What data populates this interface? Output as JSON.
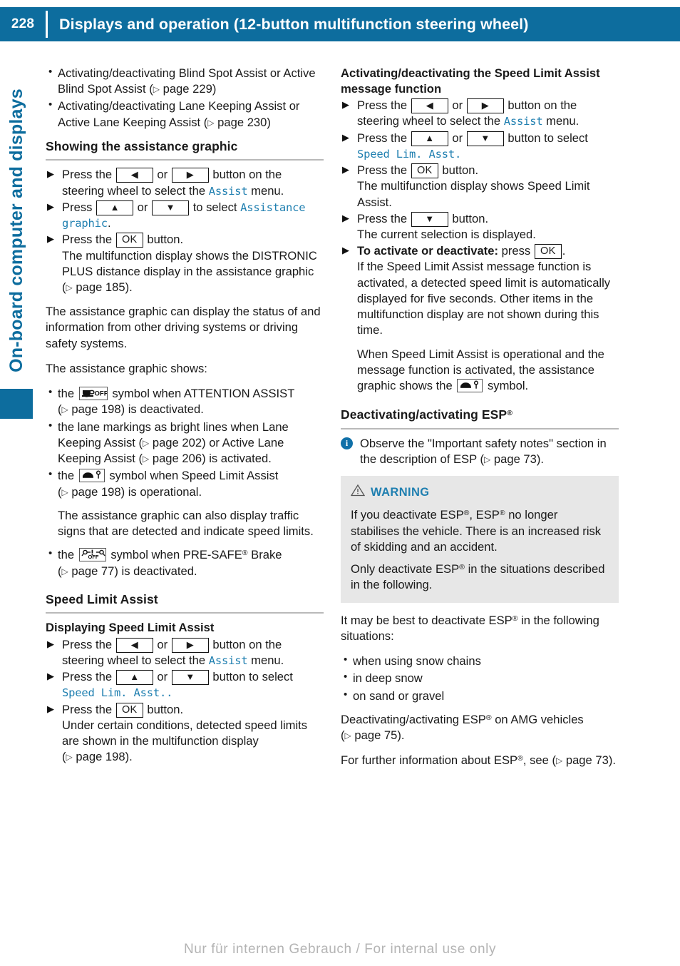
{
  "header": {
    "page_number": "228",
    "title": "Displays and operation (12-button multifunction steering wheel)",
    "bg_color": "#0d6d9e"
  },
  "sidebar": {
    "label": "On-board computer and displays",
    "color": "#0d6d9e"
  },
  "keys": {
    "left": "◀",
    "right": "▶",
    "up": "▲",
    "down": "▼",
    "ok": "OK"
  },
  "left_column": {
    "intro_bullets": [
      {
        "text_1": "Activating/deactivating Blind Spot Assist or Active Blind Spot Assist (",
        "xref": "page 229",
        "text_2": ")"
      },
      {
        "text_1": "Activating/deactivating Lane Keeping Assist or Active Lane Keeping Assist (",
        "xref": "page 230",
        "text_2": ")"
      }
    ],
    "section_showing": {
      "heading": "Showing the assistance graphic",
      "step1_a": "Press the",
      "step1_or": "or",
      "step1_b": "button on the steering wheel to select the",
      "step1_menu": "Assist",
      "step1_c": "menu.",
      "step2_a": "Press",
      "step2_or": "or",
      "step2_b": "to select",
      "step2_item": "Assistance graphic",
      "step2_c": ".",
      "step3_a": "Press the",
      "step3_b": "button.",
      "step3_result_1": "The multifunction display shows the DISTRONIC PLUS distance display in the assistance graphic (",
      "step3_xref": "page 185",
      "step3_result_2": ")."
    },
    "para_status": "The assistance graphic can display the status of and information from other driving systems or driving safety systems.",
    "para_shows": "The assistance graphic shows:",
    "symbol_bullets": [
      {
        "icon": "attention-assist-off-symbol",
        "pre": "the",
        "post_1": "symbol when ATTENTION ASSIST (",
        "xref": "page 198",
        "post_2": ") is deactivated."
      },
      {
        "icon": "none",
        "pre": "",
        "post_1": "the lane markings as bright lines when Lane Keeping Assist (",
        "xref": "page 202",
        "post_2": ") or Active Lane Keeping Assist (",
        "xref2": "page 206",
        "post_3": ") is activated."
      },
      {
        "icon": "speed-limit-assist-symbol",
        "pre": "the",
        "post_1": "symbol when Speed Limit Assist (",
        "xref": "page 198",
        "post_2": ") is operational."
      }
    ],
    "para_traffic_signs": "The assistance graphic can also display traffic signs that are detected and indicate speed limits.",
    "presafe_bullet": {
      "icon": "pre-safe-brake-off-symbol",
      "pre": "the",
      "post_1": "symbol when PRE-SAFE",
      "post_reg": "®",
      "post_2": "Brake (",
      "xref": "page 77",
      "post_3": ") is deactivated."
    },
    "section_sla": {
      "heading": "Speed Limit Assist",
      "subheading": "Displaying Speed Limit Assist",
      "step1_a": "Press the",
      "step1_or": "or",
      "step1_b": "button on the steering wheel to select the",
      "step1_menu": "Assist",
      "step1_c": "menu.",
      "step2_a": "Press the",
      "step2_or": "or",
      "step2_b": "button to select",
      "step2_item": "Speed Lim. Asst.",
      "step2_c": ".",
      "step3_a": "Press the",
      "step3_b": "button.",
      "step3_result_1": "Under certain conditions, detected speed limits are shown in the multifunction display (",
      "step3_xref": "page 198",
      "step3_result_2": ")."
    }
  },
  "right_column": {
    "section_msgfn": {
      "heading": "Activating/deactivating the Speed Limit Assist message function",
      "step1_a": "Press the",
      "step1_or": "or",
      "step1_b": "button on the steering wheel to select the",
      "step1_menu": "Assist",
      "step1_c": "menu.",
      "step2_a": "Press the",
      "step2_or": "or",
      "step2_b": "button to select",
      "step2_item": "Speed Lim. Asst.",
      "step3_a": "Press the",
      "step3_b": "button.",
      "step3_result": "The multifunction display shows Speed Limit Assist.",
      "step4_a": "Press the",
      "step4_b": "button.",
      "step4_result": "The current selection is displayed.",
      "step5_bold": "To activate or deactivate:",
      "step5_a": "press",
      "step5_b": ".",
      "step5_result": "If the Speed Limit Assist message function is activated, a detected speed limit is automatically displayed for five seconds. Other items in the multifunction display are not shown during this time.",
      "step5_result2_a": "When Speed Limit Assist is operational and the message function is activated, the assistance graphic shows the",
      "step5_icon": "speed-limit-assist-symbol",
      "step5_result2_b": "symbol."
    },
    "section_esp": {
      "heading_text": "Deactivating/activating ESP",
      "heading_reg": "®",
      "note_1": "Observe the \"Important safety notes\" section in the description of ESP (",
      "note_xref": "page 73",
      "note_2": ").",
      "warning": {
        "label": "WARNING",
        "label_color": "#1f7fb0",
        "bg_color": "#e7e7e7",
        "p1_a": "If you deactivate ESP",
        "p1_reg1": "®",
        "p1_b": ", ESP",
        "p1_reg2": "®",
        "p1_c": " no longer stabilises the vehicle. There is an increased risk of skidding and an accident.",
        "p2_a": "Only deactivate ESP",
        "p2_reg": "®",
        "p2_b": " in the situations described in the following."
      },
      "para_best_a": "It may be best to deactivate ESP",
      "para_best_reg": "®",
      "para_best_b": " in the following situations:",
      "situations": [
        "when using snow chains",
        "in deep snow",
        "on sand or gravel"
      ],
      "para_amg_a": "Deactivating/activating ESP",
      "para_amg_reg": "®",
      "para_amg_b": " on AMG vehicles (",
      "para_amg_xref": "page 75",
      "para_amg_c": ").",
      "para_more_a": "For further information about ESP",
      "para_more_reg": "®",
      "para_more_b": ", see (",
      "para_more_xref": "page 73",
      "para_more_c": ")."
    }
  },
  "footer": {
    "watermark": "Nur für internen Gebrauch / For internal use only"
  }
}
